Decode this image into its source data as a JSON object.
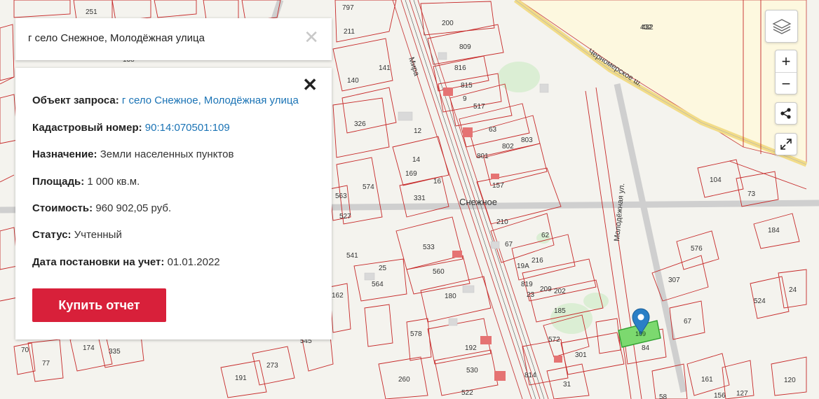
{
  "search": {
    "value": "г село Снежное, Молодёжная улица",
    "clear_icon": "close-icon"
  },
  "info": {
    "query_label": "Объект запроса:",
    "query_value": "г село Снежное, Молодёжная улица",
    "cadastral_label": "Кадастровый номер:",
    "cadastral_value": "90:14:070501:109",
    "purpose_label": "Назначение:",
    "purpose_value": "Земли населенных пунктов",
    "area_label": "Площадь:",
    "area_value": "1 000 кв.м.",
    "cost_label": "Стоимость:",
    "cost_value": "960 902,05 руб.",
    "status_label": "Статус:",
    "status_value": "Учтенный",
    "date_label": "Дата постановки на учет:",
    "date_value": "01.01.2022",
    "buy_label": "Купить отчет"
  },
  "controls": {
    "layers_icon": "layers-icon",
    "zoom_in": "+",
    "zoom_out": "−",
    "share_icon": "share-icon",
    "fullscreen_icon": "fullscreen-icon"
  },
  "map": {
    "place_label": "Снежное",
    "street_labels": [
      "Молодёжная ул.",
      "Черномерское ш.",
      "Мира"
    ],
    "parcel_labels": [
      "251",
      "797",
      "211",
      "200",
      "809",
      "816",
      "815",
      "138",
      "140",
      "141",
      "432",
      "517",
      "9",
      "63",
      "326",
      "12",
      "801",
      "802",
      "803",
      "157",
      "169",
      "331",
      "14",
      "16",
      "104",
      "73",
      "563",
      "574",
      "527",
      "210",
      "62",
      "533",
      "67",
      "184",
      "576",
      "541",
      "25",
      "564",
      "560",
      "216",
      "19А",
      "819",
      "307",
      "162",
      "180",
      "209",
      "202",
      "185",
      "23",
      "67",
      "524",
      "24",
      "578",
      "572",
      "84",
      "545",
      "192",
      "301",
      "530",
      "70",
      "77",
      "174",
      "335",
      "191",
      "273",
      "260",
      "522",
      "814",
      "161",
      "127",
      "156",
      "58",
      "120",
      "31",
      "432"
    ],
    "highlighted_parcel": "109",
    "accent_color": "#d8203a",
    "link_color": "#1a73b5",
    "marker_color": "#2a7fc6",
    "highlight_color": "#7cd96f"
  }
}
